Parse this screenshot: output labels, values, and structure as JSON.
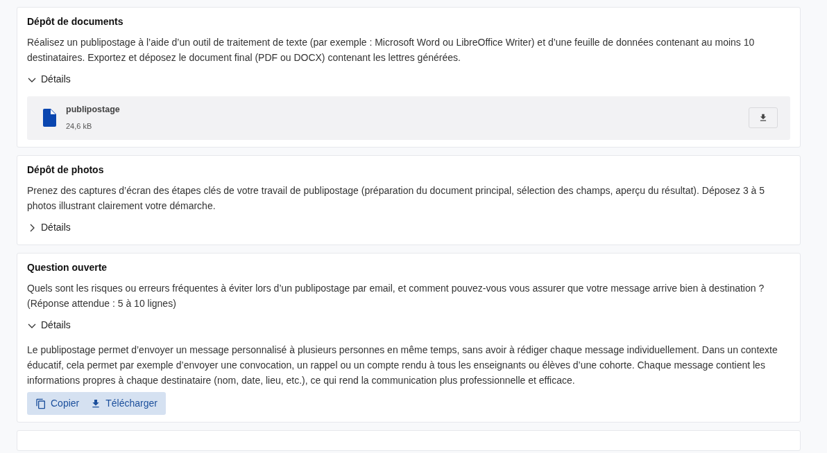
{
  "sections": [
    {
      "title": "Dépôt de documents",
      "description": "Réalisez un publipostage à l’aide d’un outil de traitement de texte (par exemple : Microsoft Word ou LibreOffice Writer) et d’une feuille de données contenant au moins 10 destinataires. Exportez et déposez le document final (PDF ou DOCX) contenant les lettres générées.",
      "details": {
        "label": "Détails",
        "expanded": true
      },
      "files": [
        {
          "name": "publipostage",
          "size": "24,6 kB"
        }
      ]
    },
    {
      "title": "Dépôt de photos",
      "description": "Prenez des captures d’écran des étapes clés de votre travail de publipostage (préparation du document principal, sélection des champs, aperçu du résultat). Déposez 3 à 5 photos illustrant clairement votre démarche.",
      "details": {
        "label": "Détails",
        "expanded": false
      }
    },
    {
      "title": "Question ouverte",
      "description": "Quels sont les risques ou erreurs fréquentes à éviter lors d’un publipostage par email, et comment pouvez-vous vous assurer que votre message arrive bien à destination ? (Réponse attendue : 5 à 10 lignes)",
      "details": {
        "label": "Détails",
        "expanded": true
      },
      "answer": {
        "text": "Le publipostage permet d’envoyer un message personnalisé à plusieurs personnes en même temps, sans avoir à rédiger chaque message individuellement. Dans un contexte éducatif, cela permet par exemple d’envoyer une convocation, un rappel ou un compte rendu à tous les enseignants ou élèves d’une cohorte. Chaque message contient les informations propres à chaque destinataire (nom, date, lieu, etc.), ce qui rend la communication plus professionnelle et efficace.",
        "actions": [
          {
            "kind": "copy",
            "label": "Copier"
          },
          {
            "kind": "download",
            "label": "Télécharger"
          }
        ]
      }
    }
  ]
}
